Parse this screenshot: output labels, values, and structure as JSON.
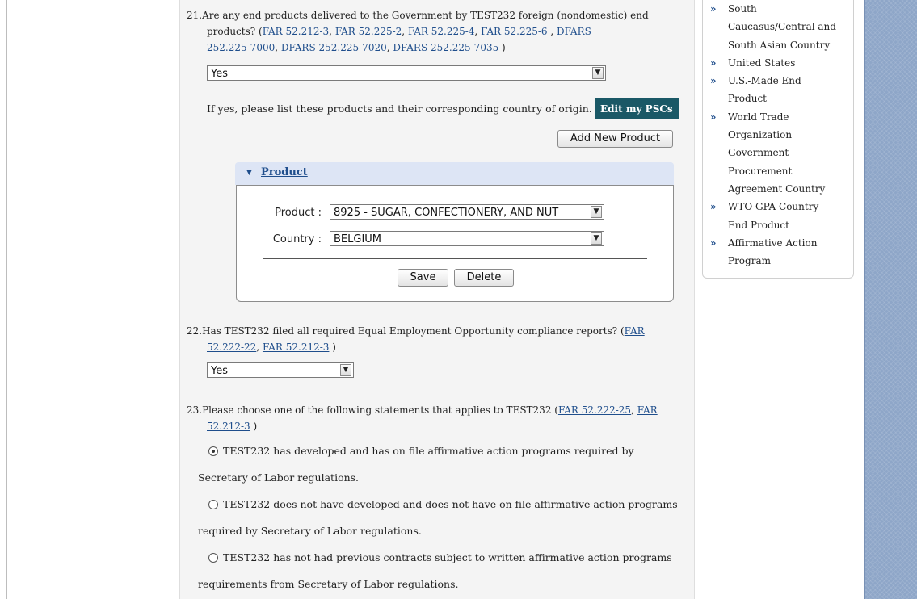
{
  "questions": {
    "q21": {
      "number": "21.",
      "line1": "Are any end products delivered to the Government by TEST232 foreign (nondomestic) end",
      "line2_prefix": "products? (",
      "links_line2": [
        "FAR 52.212-3",
        "FAR 52.225-2",
        "FAR 52.225-4",
        "FAR 52.225-6",
        "DFARS"
      ],
      "links_line3": [
        "252.225-7000",
        "DFARS 252.225-7020",
        "DFARS 252.225-7035"
      ],
      "select_value": "Yes",
      "followup_text": "If yes, please list these products and their corresponding country of origin.",
      "edit_pscs_label": "Edit my PSCs",
      "add_product_label": "Add New Product",
      "product_panel": {
        "title": "Product",
        "product_label": "Product :",
        "product_value": "8925 - SUGAR, CONFECTIONERY, AND NUT",
        "country_label": "Country :",
        "country_value": "BELGIUM",
        "save_label": "Save",
        "delete_label": "Delete"
      }
    },
    "q22": {
      "number": "22.",
      "line1": "Has TEST232 filed all required Equal Employment Opportunity compliance reports? (",
      "link1a": "FAR",
      "link1b": "52.222-22",
      "link2": "FAR 52.212-3",
      "select_value": "Yes"
    },
    "q23": {
      "number": "23.",
      "line1": "Please choose one of the following statements that applies to TEST232 (",
      "link1": "FAR 52.222-25",
      "link2a": "FAR",
      "link2b": "52.212-3",
      "options": [
        {
          "line1": "TEST232 has developed and has on file affirmative action programs required by",
          "line2": "Secretary of Labor regulations.",
          "selected": true
        },
        {
          "line1": "TEST232 does not have developed and does not have on file affirmative action programs",
          "line2": "required by Secretary of Labor regulations.",
          "selected": false
        },
        {
          "line1": "TEST232 has not had previous contracts subject to written affirmative action programs",
          "line2": "requirements from Secretary of Labor regulations.",
          "selected": false
        }
      ]
    }
  },
  "sidebar": {
    "bullet": "»",
    "items": [
      {
        "lines": [
          "South",
          "Caucasus/Central and",
          "South Asian Country"
        ]
      },
      {
        "lines": [
          "United States"
        ]
      },
      {
        "lines": [
          "U.S.-Made End",
          "Product"
        ]
      },
      {
        "lines": [
          "World Trade",
          "Organization",
          "Government",
          "Procurement",
          "Agreement Country"
        ]
      },
      {
        "lines": [
          "WTO GPA Country",
          "End Product"
        ]
      },
      {
        "lines": [
          "Affirmative Action",
          "Program"
        ]
      }
    ]
  },
  "colors": {
    "link": "#1f4e8c",
    "edit_button_bg": "#1a5866",
    "product_header_bg": "#dde5f5",
    "right_panel_bg": "#8ea6c8"
  }
}
